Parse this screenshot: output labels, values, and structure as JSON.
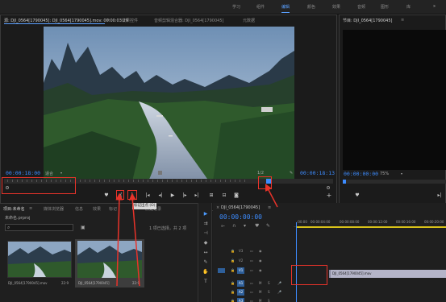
{
  "topbar": {
    "workspaces": [
      "学习",
      "组件",
      "编辑",
      "颜色",
      "效果",
      "音频",
      "图形",
      "库"
    ],
    "active": "编辑",
    "more": "»"
  },
  "source": {
    "tabs": [
      "源: DJI_0564[1790045]: DJI_0564[1790045].mov: 00:00:03:29",
      "效果控件",
      "音频剪辑混合器: DJI_0564[1790045]",
      "元数据"
    ],
    "tab_menu": "≡",
    "timecode_left": "00:00:18:00",
    "fit": "适合",
    "fit_arrow": "▾",
    "ratio": "1/2",
    "timecode_right": "00:00:18:13",
    "tooltip": "标记出点 (O)"
  },
  "program": {
    "title": "节目: DJI_0564[1790045]",
    "title_menu": "≡",
    "timecode": "00:00:00:00",
    "zoom": "75%",
    "zoom_arrow": "▾"
  },
  "project": {
    "tabs": [
      "项目:未命名",
      "媒体浏览器",
      "信息",
      "效果",
      "标记",
      "历史记录"
    ],
    "tab_menu": "≡",
    "file": "未命名.prproj",
    "selection": "1 项已选择，共 2 项",
    "items": [
      {
        "name": "DJI_0564[1790045].mov",
        "duration": "22:9"
      },
      {
        "name": "DJI_0564[1790045]",
        "duration": "22:9"
      }
    ]
  },
  "timeline": {
    "title": "DJI_0564[1790045]",
    "title_close": "×",
    "title_menu": "≡",
    "timecode": "00:00:00:00",
    "ruler": [
      ":00:00",
      "00:00:04:00",
      "00:00:08:00",
      "00:00:12:00",
      "00:00:16:00",
      "00:00:20:00"
    ],
    "tracks": [
      "V3",
      "V2",
      "V1",
      "A1",
      "A2",
      "A3"
    ],
    "clip": "DJI_0564[1790045].mov"
  },
  "colors": {
    "accent": "#3d8cff",
    "annotation": "#e8332a",
    "clip": "#b4b4c8"
  }
}
